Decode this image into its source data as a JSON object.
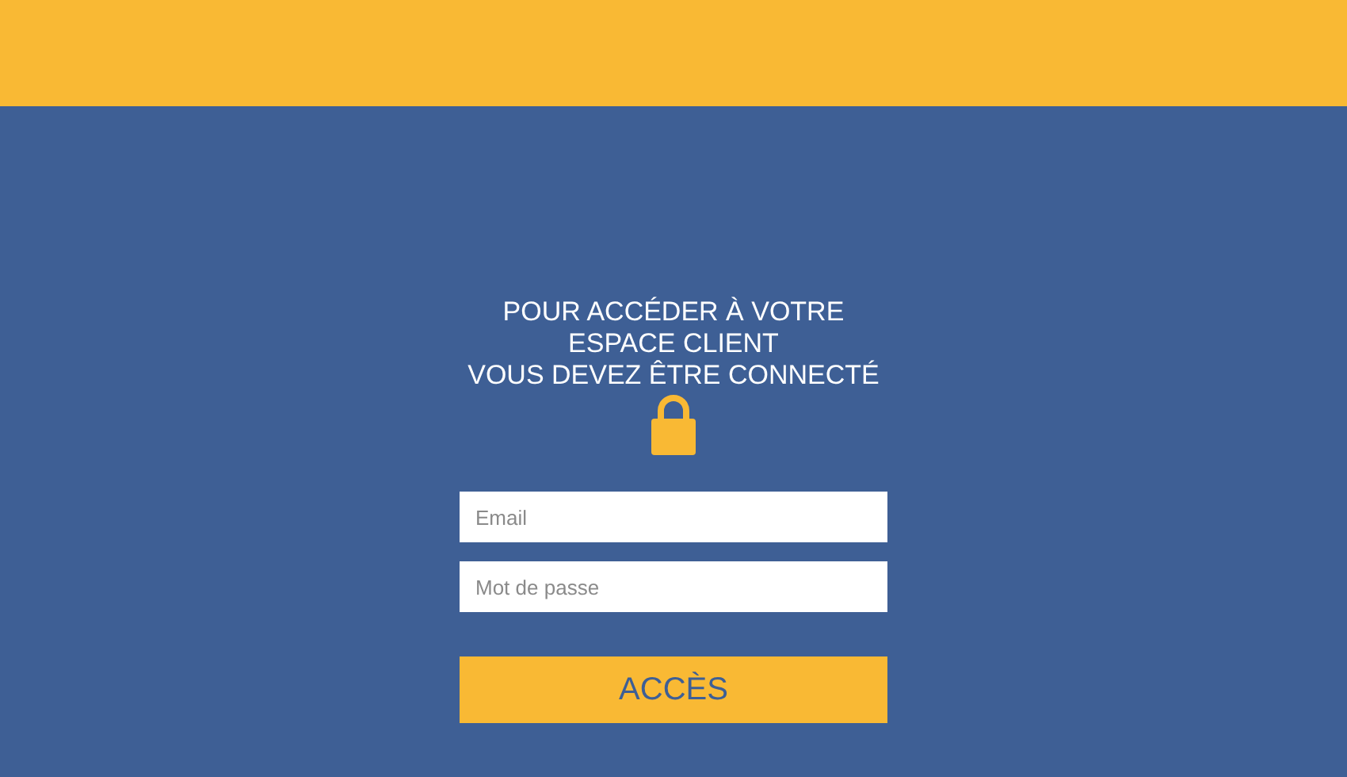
{
  "heading_lines": [
    "POUR ACCÉDER À VOTRE",
    "ESPACE CLIENT",
    "VOUS DEVEZ ÊTRE CONNECTÉ"
  ],
  "fields": [
    {
      "placeholder": "Email"
    },
    {
      "placeholder": "Mot de passe"
    }
  ],
  "button": {
    "label": "ACCÈS"
  }
}
